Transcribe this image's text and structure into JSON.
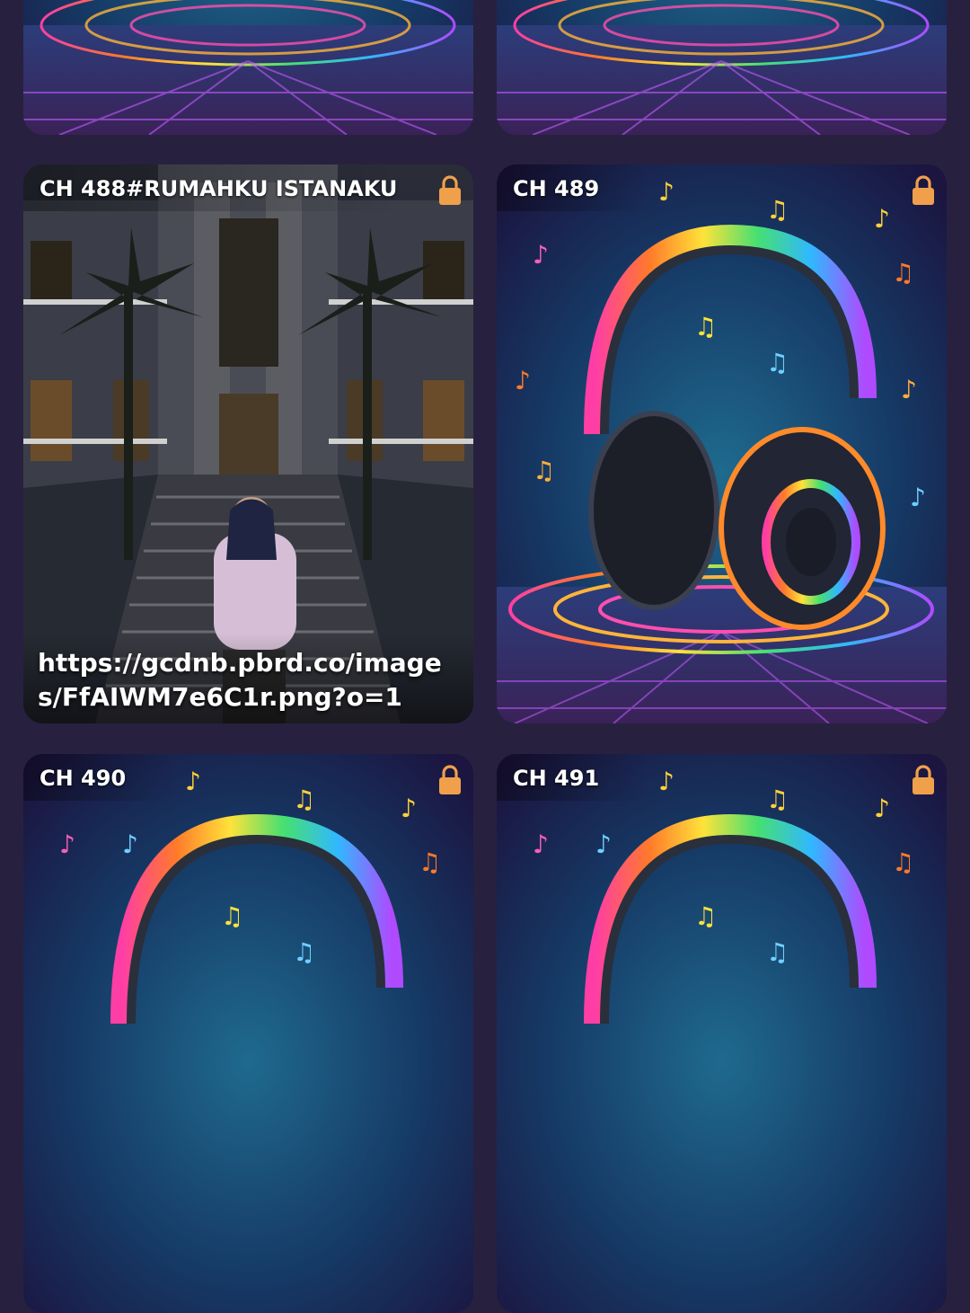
{
  "cards": [
    {
      "title": "",
      "image": "headphones-artwork",
      "locked": false
    },
    {
      "title": "",
      "image": "headphones-artwork",
      "locked": false
    },
    {
      "title": "CH 488#RUMAHKU ISTANAKU",
      "image": "house-photo",
      "caption": "https://gcdnb.pbrd.co/images/FfAIWM7e6C1r.png?o=1",
      "locked": true
    },
    {
      "title": "CH 489",
      "image": "headphones-artwork",
      "locked": true
    },
    {
      "title": "CH 490",
      "image": "headphones-artwork",
      "locked": true
    },
    {
      "title": "CH 491",
      "image": "headphones-artwork",
      "locked": true
    }
  ],
  "colors": {
    "background": "#27213f",
    "lock": "#f0a04b",
    "label": "#ffffff"
  },
  "icons": {
    "lock": "lock-icon"
  }
}
